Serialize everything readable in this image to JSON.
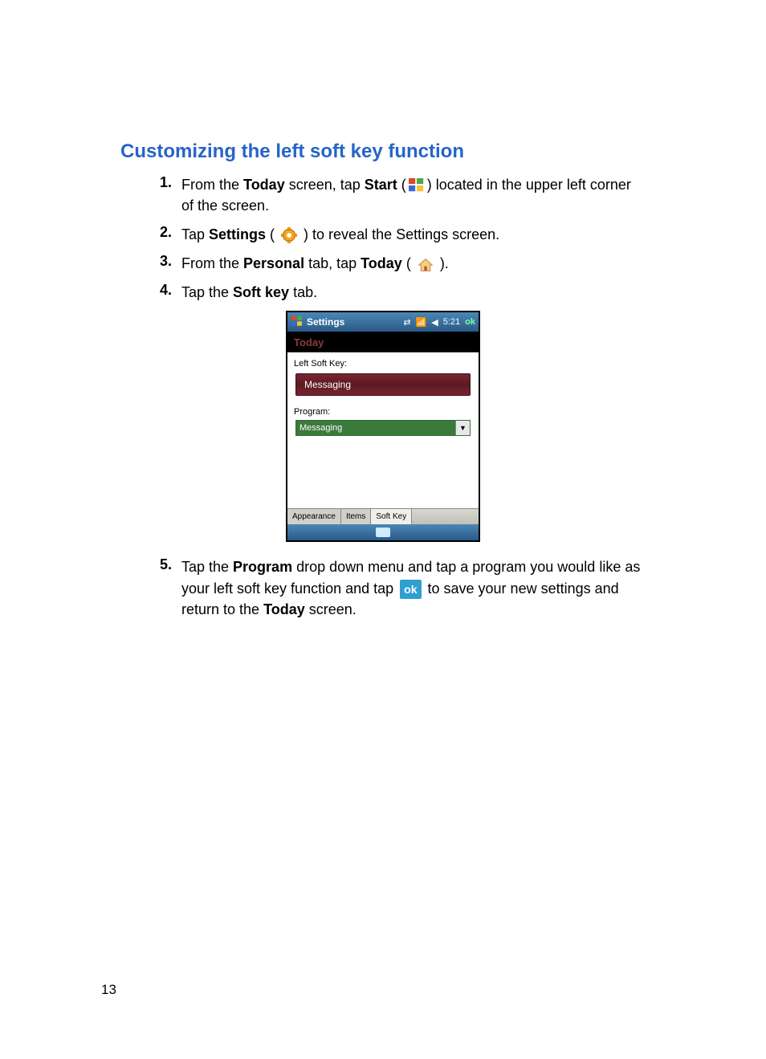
{
  "heading": "Customizing the left soft key function",
  "steps": {
    "s1": {
      "num": "1.",
      "pre": "From the ",
      "b1": "Today",
      "mid1": " screen, tap ",
      "b2": "Start",
      "mid2": " (",
      "mid3": ") located in the upper left corner of the screen."
    },
    "s2": {
      "num": "2.",
      "pre": "Tap ",
      "b1": "Settings",
      "mid1": " ( ",
      "mid2": " ) to reveal the Settings screen."
    },
    "s3": {
      "num": "3.",
      "pre": "From the ",
      "b1": "Personal",
      "mid1": " tab, tap ",
      "b2": "Today",
      "mid2": " ( ",
      "mid3": " )."
    },
    "s4": {
      "num": "4.",
      "pre": "Tap the ",
      "b1": "Soft key",
      "post": " tab."
    },
    "s5": {
      "num": "5.",
      "pre": "Tap the ",
      "b1": "Program",
      "mid1": " drop down menu and tap a program you would like as your left soft key function and tap ",
      "ok": "ok",
      "mid2": " to save your new settings and return to the ",
      "b2": "Today",
      "post": " screen."
    }
  },
  "phone": {
    "title": "Settings",
    "time": "5:21",
    "ok": "ok",
    "today": "Today",
    "left_soft_key": "Left Soft Key:",
    "messaging_btn": "Messaging",
    "program_label": "Program:",
    "dropdown_value": "Messaging",
    "tab_appearance": "Appearance",
    "tab_items": "Items",
    "tab_softkey": "Soft Key"
  },
  "page_number": "13"
}
